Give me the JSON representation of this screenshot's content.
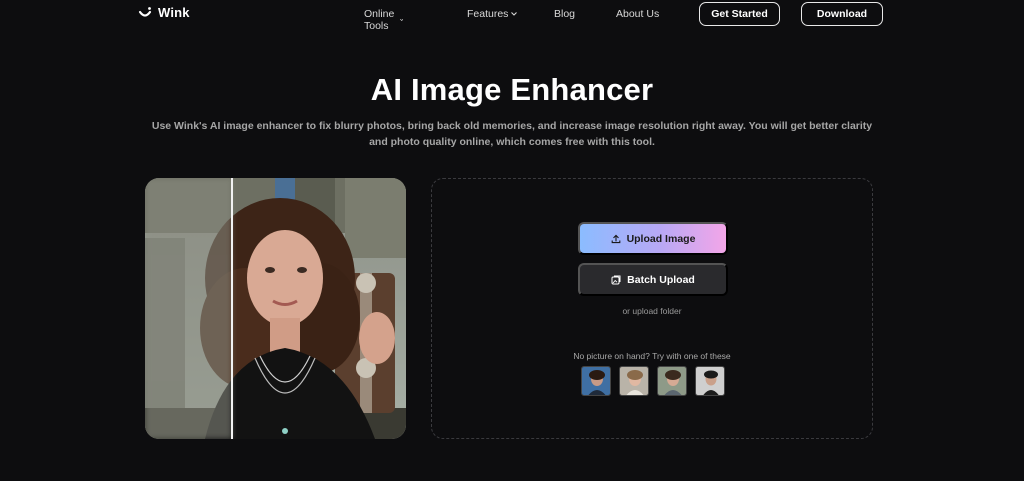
{
  "nav": {
    "logo_text": "Wink",
    "links": [
      {
        "label": "Online Tools",
        "has_dropdown": true
      },
      {
        "label": "Features",
        "has_dropdown": true
      },
      {
        "label": "Blog",
        "has_dropdown": false
      },
      {
        "label": "About Us",
        "has_dropdown": false
      }
    ],
    "get_started_label": "Get Started",
    "download_label": "Download"
  },
  "hero": {
    "title": "AI Image Enhancer",
    "subtitle": "Use Wink's AI image enhancer to fix blurry photos, bring back old memories, and increase image resolution right away. You will get better clarity and photo quality online, which comes free with this tool."
  },
  "upload": {
    "upload_label": "Upload Image",
    "batch_label": "Batch Upload",
    "folder_text": "or upload folder",
    "try_text": "No picture on hand? Try with one of these"
  },
  "colors": {
    "background": "#0d0d0f",
    "gradient_start": "#8bbcff",
    "gradient_end": "#f3a6e8"
  }
}
